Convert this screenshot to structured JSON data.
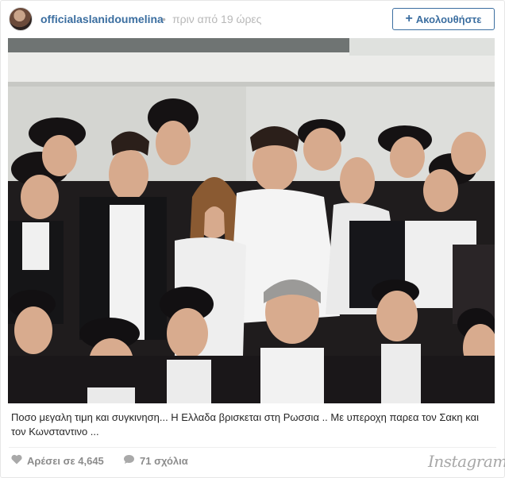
{
  "header": {
    "username": "officialaslanidoumelina",
    "separator": "•",
    "timestamp": "πριν από 19 ώρες",
    "follow_label": "Ακολουθήστε",
    "follow_icon": "plus-icon",
    "avatar_icon": "profile-avatar"
  },
  "post": {
    "photo_icon": "group-photo",
    "caption": "Ποσο μεγαλη τιμη και συγκινηση... Η Ελλαδα βρισκεται στη Ρωσσια .. Με υπεροχη παρεα τον Σακη και τον Κωνσταντινο ..."
  },
  "footer": {
    "likes_text": "Αρέσει σε 4,645",
    "likes_icon": "heart-icon",
    "comments_text": "71 σχόλια",
    "comments_icon": "speech-bubble-icon",
    "brand_logo": "Instagram"
  },
  "colors": {
    "link_blue": "#3b6ea0",
    "muted_gray": "#b8b8b8",
    "footer_gray": "#8c8c8c"
  }
}
